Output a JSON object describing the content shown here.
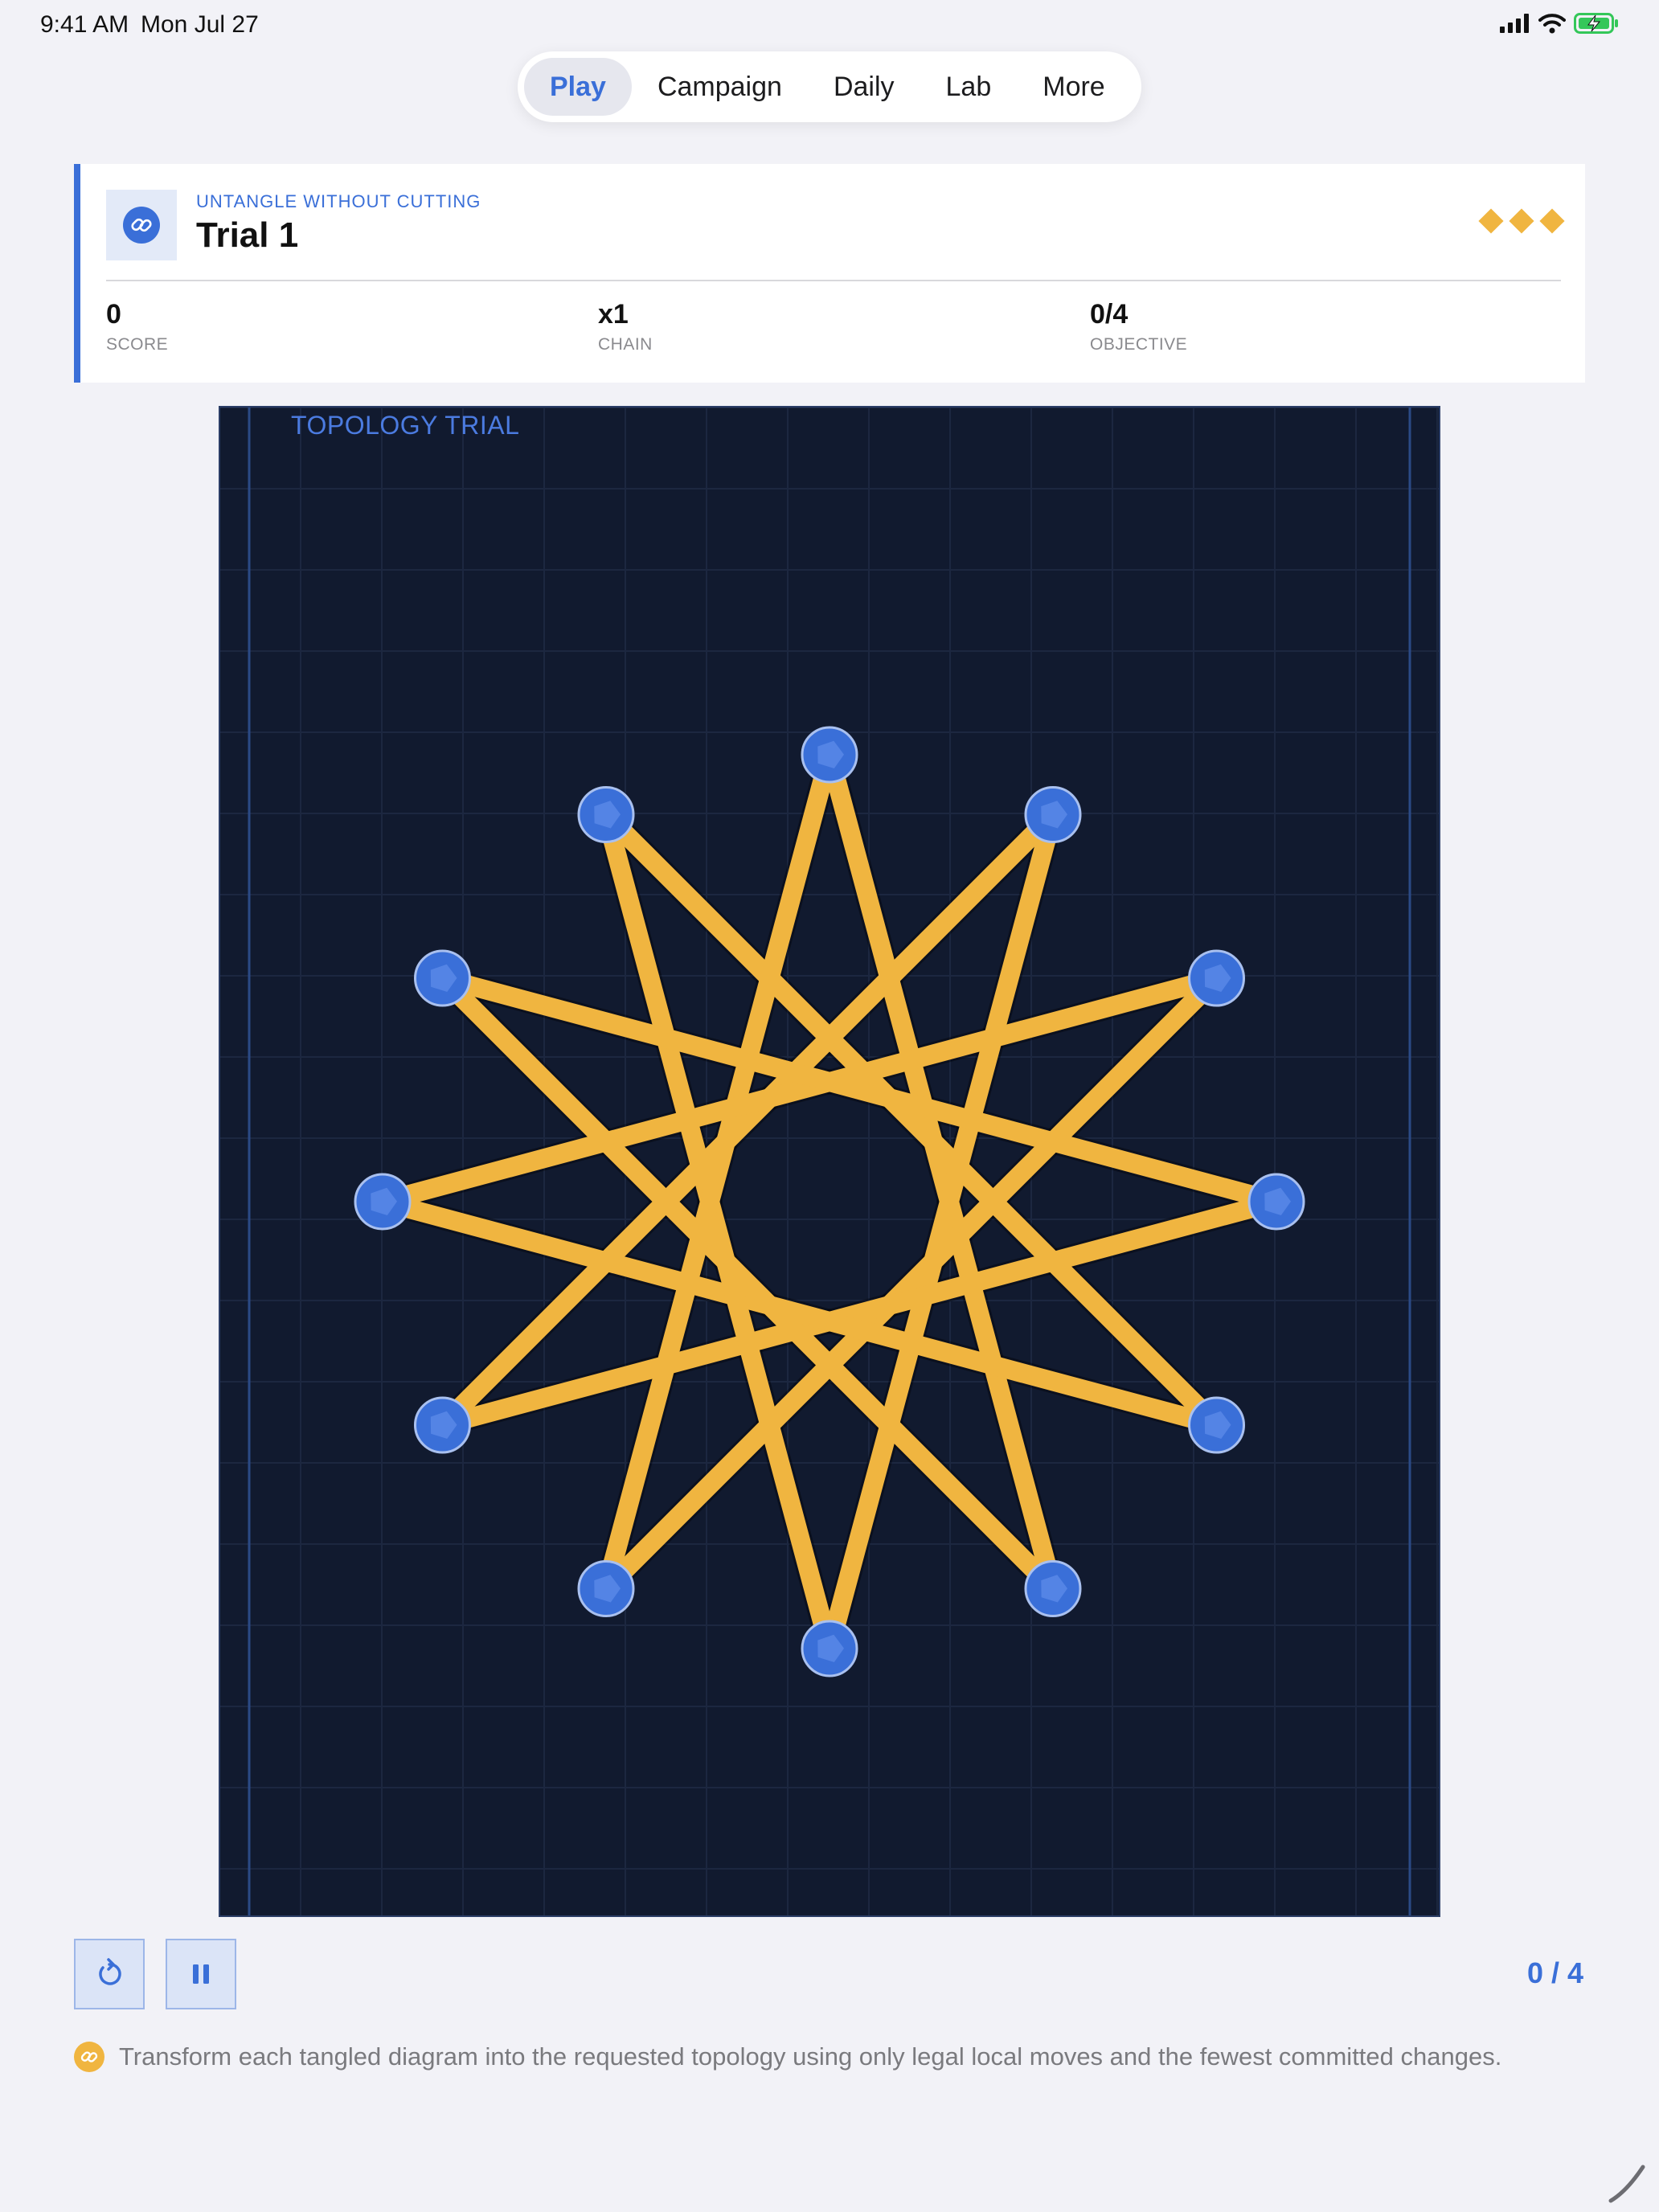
{
  "status": {
    "time": "9:41 AM",
    "date": "Mon Jul 27"
  },
  "nav": {
    "tabs": [
      "Play",
      "Campaign",
      "Daily",
      "Lab",
      "More"
    ],
    "active": "Play"
  },
  "header": {
    "kicker": "UNTANGLE WITHOUT CUTTING",
    "title": "Trial 1",
    "rating_max": 3,
    "stats": [
      {
        "value": "0",
        "label": "SCORE"
      },
      {
        "value": "x1",
        "label": "CHAIN"
      },
      {
        "value": "0/4",
        "label": "OBJECTIVE"
      }
    ]
  },
  "board": {
    "label": "TOPOLOGY TRIAL",
    "node_count": 12,
    "star_step": 5,
    "colors": {
      "background": "#111a2f",
      "strand": "#f0b540",
      "node": "#3a6fd8",
      "node_stroke": "#a9c0ef"
    }
  },
  "controls": {
    "reset_icon": "rotate-ccw-icon",
    "pause_icon": "pause-icon",
    "progress": "0 / 4"
  },
  "hint": {
    "text": "Transform each tangled diagram into the requested topology using only legal local moves and the fewest committed changes."
  }
}
